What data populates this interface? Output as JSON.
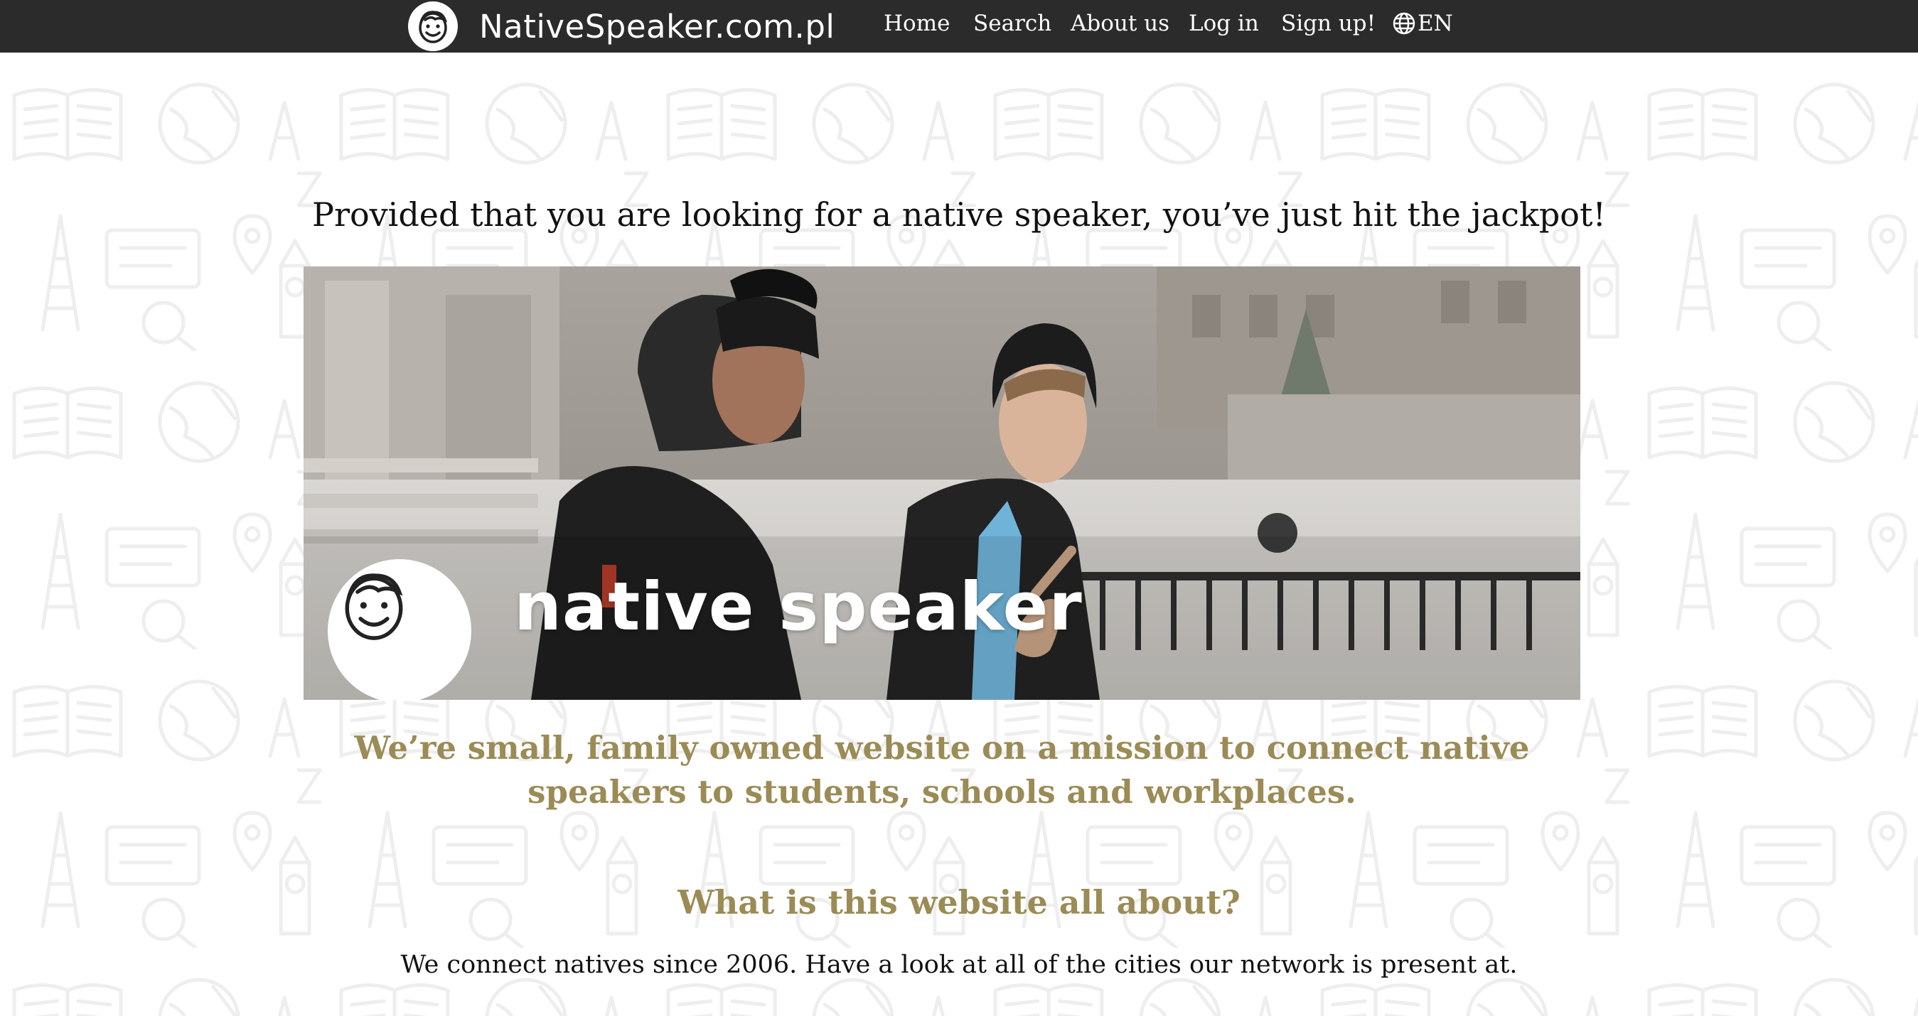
{
  "header": {
    "brand_name": "NativeSpeaker.com.pl",
    "nav": {
      "home": "Home",
      "search": "Search",
      "about": "About us",
      "login": "Log in",
      "signup": "Sign up!"
    },
    "language": "EN",
    "icons": [
      "smiley-face-logo-icon",
      "globe-icon"
    ]
  },
  "main": {
    "tagline": "Provided that you are looking for a native speaker, you’ve just hit the jackpot!",
    "hero": {
      "overlay_text": "native speaker",
      "image_subject": "two smiling young men in winter clothes talking outdoors"
    },
    "mission": "We’re small, family owned website on a mission to connect native speakers to students, schools and workplaces.",
    "about_heading": "What is this website all about?",
    "about_text": "We connect natives since 2006. Have a look at all of the cities our network is present at."
  },
  "colors": {
    "topbar": "#2b2b2b",
    "accent_gold": "#9b8b55",
    "text_dark": "#111111",
    "background": "#ffffff"
  }
}
